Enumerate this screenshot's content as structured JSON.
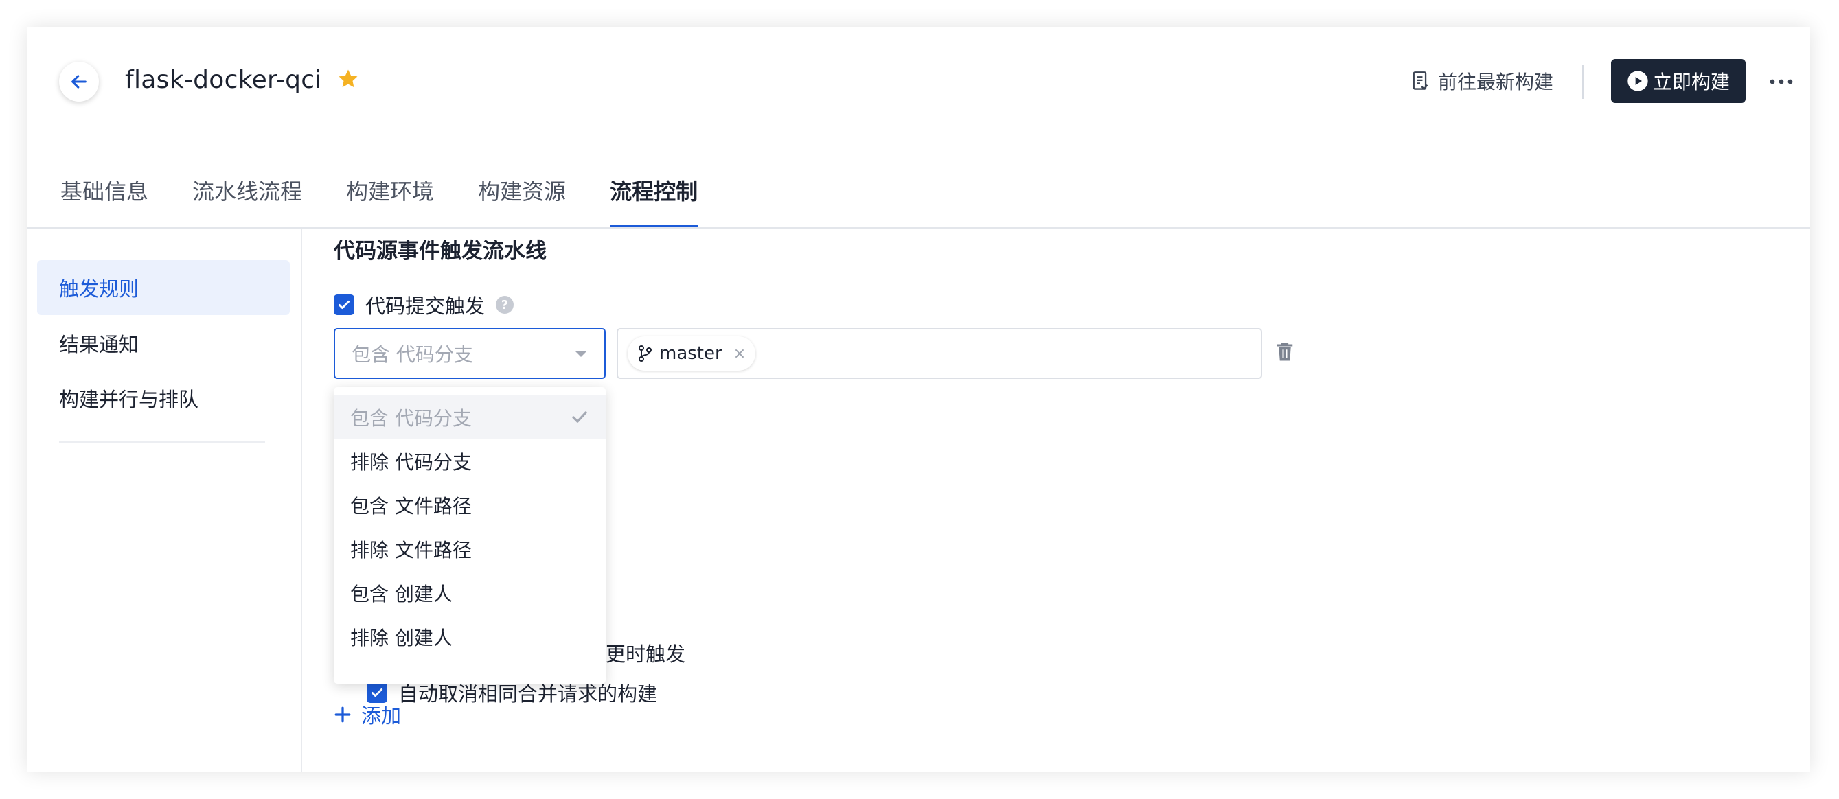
{
  "header": {
    "title": "flask-docker-qci",
    "goto_latest_label": "前往最新构建",
    "build_now_label": "立即构建"
  },
  "tabs": [
    {
      "label": "基础信息"
    },
    {
      "label": "流水线流程"
    },
    {
      "label": "构建环境"
    },
    {
      "label": "构建资源"
    },
    {
      "label": "流程控制",
      "active": true
    }
  ],
  "sidebar": {
    "items": [
      {
        "label": "触发规则",
        "active": true
      },
      {
        "label": "结果通知"
      },
      {
        "label": "构建并行与排队"
      }
    ]
  },
  "main": {
    "section_title": "代码源事件触发流水线",
    "commit_trigger_label": "代码提交触发",
    "condition_select": {
      "value": "包含 代码分支",
      "options": [
        "包含 代码分支",
        "排除 代码分支",
        "包含 文件路径",
        "排除 文件路径",
        "包含 创建人",
        "排除 创建人"
      ]
    },
    "branch_tags": [
      "master"
    ],
    "partial_trigger_text": "更时触发",
    "auto_cancel_label": "自动取消相同合并请求的构建",
    "add_label": "添加"
  },
  "colors": {
    "accent": "#1c5bd8",
    "primary_button": "#1b2536",
    "star": "#f5b223"
  }
}
